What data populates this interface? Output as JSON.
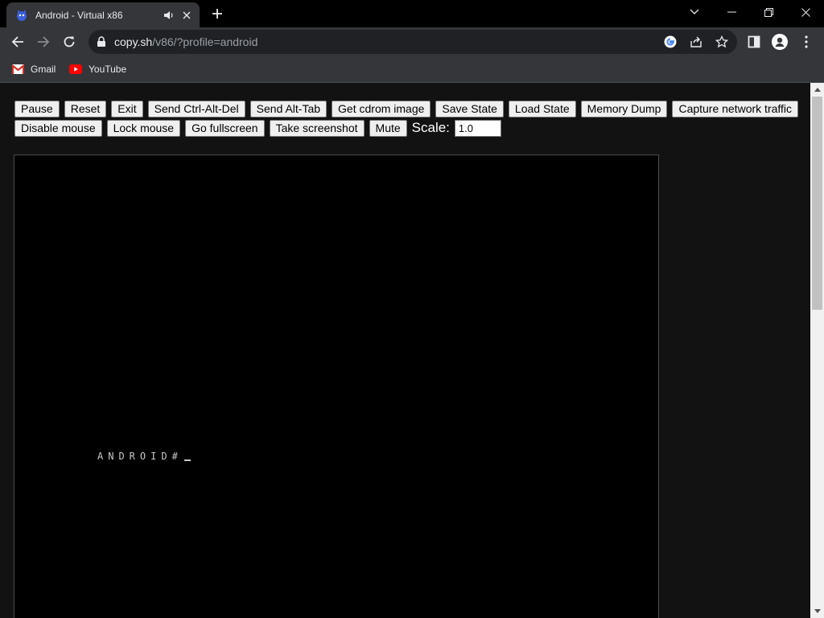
{
  "browser": {
    "tab": {
      "title": "Android - Virtual x86",
      "favicon": "v86-favicon",
      "audio_icon": "speaker-icon",
      "close_icon": "close-icon"
    },
    "new_tab_icon": "plus-icon",
    "window_controls": [
      "chevron-down-icon",
      "minimize-icon",
      "restore-icon",
      "close-icon"
    ],
    "nav": [
      "back-icon",
      "forward-icon",
      "reload-icon"
    ],
    "address": {
      "host": "copy.sh",
      "path": "/v86/?profile=android",
      "lock_icon": "lock-icon"
    },
    "omnibox_icons": [
      "google-icon",
      "share-icon",
      "star-icon"
    ],
    "toolbar_right": [
      "side-panel-icon",
      "profile-icon",
      "kebab-menu-icon"
    ],
    "bookmarks": [
      {
        "label": "Gmail",
        "icon": "gmail-icon"
      },
      {
        "label": "YouTube",
        "icon": "youtube-icon"
      }
    ]
  },
  "controls": {
    "row1": [
      "Pause",
      "Reset",
      "Exit",
      "Send Ctrl-Alt-Del",
      "Send Alt-Tab",
      "Get cdrom image",
      "Save State",
      "Load State",
      "Memory Dump",
      "Capture network traffic"
    ],
    "row2": [
      "Disable mouse",
      "Lock mouse",
      "Go fullscreen",
      "Take screenshot",
      "Mute"
    ],
    "scale_label": "Scale:",
    "scale_value": "1.0"
  },
  "screen": {
    "console_text": "ANDROID#"
  },
  "colors": {
    "tabstrip": "#000000",
    "toolbar": "#35363a",
    "page_background": "#121212",
    "screen": "#000000",
    "console_text": "#c8c8c8"
  }
}
